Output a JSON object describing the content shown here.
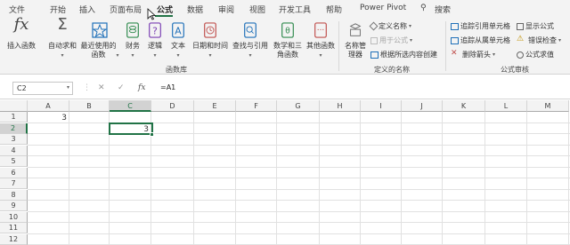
{
  "tabs": [
    "文件",
    "开始",
    "插入",
    "页面布局",
    "公式",
    "数据",
    "审阅",
    "视图",
    "开发工具",
    "帮助",
    "Power Pivot",
    "搜索"
  ],
  "active_tab": "公式",
  "ribbon": {
    "insert_function": "插入函数",
    "autosum": "自动求和",
    "recent": "最近使用的函数",
    "financial": "财务",
    "logical": "逻辑",
    "text": "文本",
    "datetime": "日期和时间",
    "lookup": "查找与引用",
    "math": "数学和三角函数",
    "more": "其他函数",
    "group_library": "函数库",
    "name_manager": "名称管理器",
    "define_name": "定义名称",
    "use_in_formula": "用于公式",
    "create_from_selection": "根据所选内容创建",
    "group_names": "定义的名称",
    "trace_precedents": "追踪引用单元格",
    "trace_dependents": "追踪从属单元格",
    "remove_arrows": "删除箭头",
    "show_formulas": "显示公式",
    "error_checking": "错误检查",
    "evaluate_formula": "公式求值",
    "group_audit": "公式审核"
  },
  "formula_bar": {
    "name_box": "C2",
    "cancel": "✕",
    "enter": "✓",
    "fx": "fx",
    "formula": "=A1"
  },
  "grid": {
    "columns": [
      "A",
      "B",
      "C",
      "D",
      "E",
      "F",
      "G",
      "H",
      "I",
      "J",
      "K",
      "L",
      "M"
    ],
    "selected_column": "C",
    "rows": [
      "1",
      "2",
      "3",
      "4",
      "5",
      "6",
      "7",
      "8",
      "9",
      "10",
      "11",
      "12"
    ],
    "selected_row": "2",
    "cells": {
      "A1": "3",
      "C2": "3"
    }
  },
  "colors": {
    "accent": "#217346",
    "ribbon_bg": "#f3f3f3"
  }
}
